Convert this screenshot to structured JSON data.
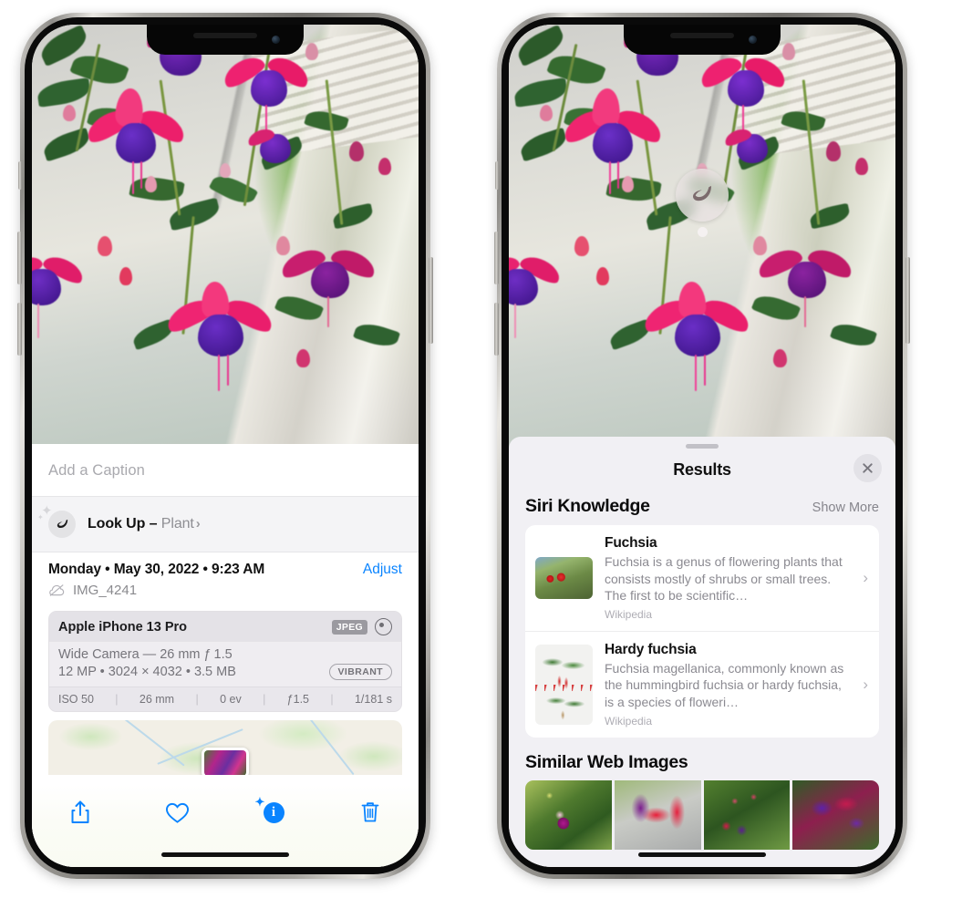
{
  "left_phone": {
    "caption": {
      "placeholder": "Add a Caption",
      "value": ""
    },
    "lookup_row": {
      "icon": "leaf-icon",
      "sparkle_icon": "sparkles-icon",
      "label": "Look Up – ",
      "subject": "Plant",
      "chevron": "›"
    },
    "metadata": {
      "date": "Monday • May 30, 2022 • 9:23 AM",
      "adjust_label": "Adjust",
      "cloud_icon": "cloud-slash-icon",
      "filename": "IMG_4241"
    },
    "exif": {
      "device": "Apple iPhone 13 Pro",
      "format_tag": "JPEG",
      "aperture_icon": "aperture-icon",
      "lens_line": "Wide Camera — 26 mm ƒ 1.5",
      "size_line": "12 MP • 3024 × 4032 • 3.5 MB",
      "style_tag": "VIBRANT",
      "stats": [
        "ISO 50",
        "26 mm",
        "0 ev",
        "ƒ1.5",
        "1/181 s"
      ],
      "separator": "|"
    },
    "toolbar": [
      {
        "name": "share-button",
        "icon": "share-icon",
        "color": "#0a84ff"
      },
      {
        "name": "favorite-button",
        "icon": "heart-icon",
        "color": "#0a84ff"
      },
      {
        "name": "info-button",
        "icon": "info-sparkle-icon",
        "color": "#0a84ff",
        "glyph": "i"
      },
      {
        "name": "delete-button",
        "icon": "trash-icon",
        "color": "#0a84ff"
      }
    ]
  },
  "right_phone": {
    "lookup_bubble": {
      "icon": "leaf-icon"
    },
    "sheet": {
      "title": "Results",
      "close_icon": "close-icon",
      "grabber": "drag-handle"
    },
    "siri_knowledge": {
      "heading": "Siri Knowledge",
      "show_more": "Show More",
      "cards": [
        {
          "title": "Fuchsia",
          "description": "Fuchsia is a genus of flowering plants that consists mostly of shrubs or small trees. The first to be scientific…",
          "source": "Wikipedia",
          "chevron": "›"
        },
        {
          "title": "Hardy fuchsia",
          "description": "Fuchsia magellanica, commonly known as the hummingbird fuchsia or hardy fuchsia, is a species of floweri…",
          "source": "Wikipedia",
          "chevron": "›"
        }
      ]
    },
    "similar_web_images": {
      "heading": "Similar Web Images",
      "thumbnails": [
        "fuchsia-thumb-1",
        "fuchsia-thumb-2",
        "fuchsia-thumb-3",
        "fuchsia-thumb-4"
      ]
    }
  },
  "colors": {
    "accent_blue": "#0a84ff",
    "sheet_bg": "#f1f0f4",
    "card_bg": "#ffffff",
    "secondary_text": "#8e8e93"
  }
}
